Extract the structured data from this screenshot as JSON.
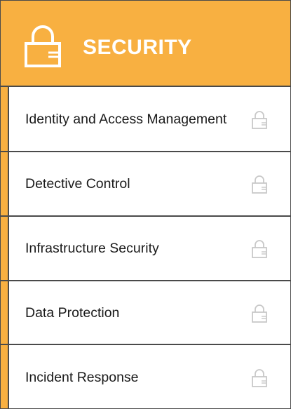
{
  "header": {
    "title": "SECURITY",
    "icon": "padlock-icon"
  },
  "items": [
    {
      "label": "Identity and Access Management",
      "icon": "padlock-icon"
    },
    {
      "label": "Detective Control",
      "icon": "padlock-icon"
    },
    {
      "label": "Infrastructure Security",
      "icon": "padlock-icon"
    },
    {
      "label": "Data Protection",
      "icon": "padlock-icon"
    },
    {
      "label": "Incident Response",
      "icon": "padlock-icon"
    }
  ],
  "colors": {
    "accent": "#f8b041",
    "border": "#4a4a4a",
    "item_icon": "#c8c8c8",
    "header_text": "#ffffff"
  }
}
